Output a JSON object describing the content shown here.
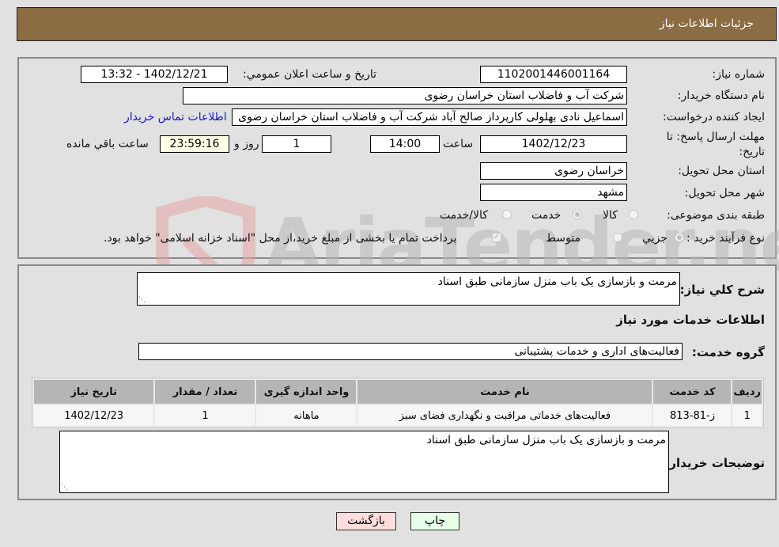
{
  "header": {
    "title": "جزئیات اطلاعات نیاز"
  },
  "colors": {
    "header_bg": "#8c6c42",
    "link": "#1a1acc",
    "print_btn_bg": "#e6ffe6",
    "back_btn_bg": "#ffdddd"
  },
  "watermark": {
    "text": "AriaTender.neT"
  },
  "form": {
    "need_number": {
      "label": "شماره نیاز:",
      "value": "1102001446001164"
    },
    "announce": {
      "label": "تاریخ و ساعت اعلان عمومي:",
      "value": "1402/12/21 - 13:32"
    },
    "buyer_org": {
      "label": "نام دستگاه خریدار:",
      "value": "شرکت آب و فاضلاب استان خراسان رضوی"
    },
    "requester": {
      "label": "ایجاد کننده درخواست:",
      "value": "اسماعیل نادی بهلولی کارپرداز صالح آباد  شرکت آب و فاضلاب استان خراسان رضوی",
      "contact_link": "اطلاعات تماس خریدار"
    },
    "deadline": {
      "label": "مهلت ارسال پاسخ: تا تاریخ:",
      "date": "1402/12/23",
      "time_label": "ساعت",
      "time": "14:00",
      "days": "1",
      "days_label": "روز و",
      "remaining": "23:59:16",
      "remaining_label": "ساعت باقي مانده"
    },
    "province": {
      "label": "استان محل تحویل:",
      "value": "خراسان رضوی"
    },
    "city": {
      "label": "شهر محل تحویل:",
      "value": "مشهد"
    },
    "category": {
      "label": "طبقه بندی موضوعی:",
      "options": [
        "کالا",
        "خدمت",
        "کالا/خدمت"
      ],
      "selected": "خدمت"
    },
    "process": {
      "label": "نوع فرآیند خرید :",
      "options": [
        "جزيي",
        "متوسط"
      ],
      "selected": "جزيي",
      "treasury_check": "پرداخت تمام یا بخشی از مبلغ خرید،از محل \"اسناد خزانه اسلامی\" خواهد بود.",
      "treasury_checked": true
    }
  },
  "details": {
    "description_label": "شرح کلي نیاز:",
    "description": "مرمت و بازسازی یک باب منزل سازمانی طبق اسناد",
    "services_title": "اطلاعات خدمات مورد نیاز",
    "service_group_label": "گروه خدمت:",
    "service_group": "فعالیت‌های اداری و خدمات پشتیبانی",
    "table": {
      "headers": [
        "ردیف",
        "کد خدمت",
        "نام خدمت",
        "واحد اندازه گیری",
        "تعداد / مقدار",
        "تاریخ نیاز"
      ],
      "rows": [
        [
          "1",
          "ز-81-813",
          "فعالیت‌های خدماتی مراقبت و نگهداری فضای سبز",
          "ماهانه",
          "1",
          "1402/12/23"
        ]
      ]
    },
    "buyer_notes_label": "توضیحات خریدار:",
    "buyer_notes": "مرمت و بازسازی یک باب منزل سازمانی طبق اسناد"
  },
  "buttons": {
    "print": "چاپ",
    "back": "بازگشت"
  }
}
